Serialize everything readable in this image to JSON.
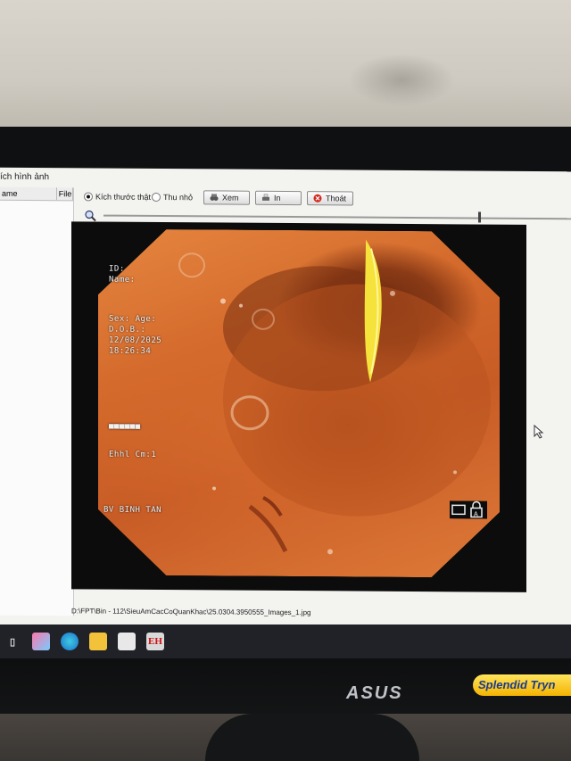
{
  "window": {
    "title_fragment": "ích hình ảnh",
    "left_headers": [
      "ame",
      "File"
    ]
  },
  "toolbar": {
    "radio_actual": "Kích thước thật",
    "radio_small": "Thu nhỏ",
    "btn_view": "Xem",
    "btn_print": "In",
    "btn_exit": "Thoát",
    "selected_radio": "actual"
  },
  "zoom": {
    "level": 0.78
  },
  "overlay": {
    "id": "ID:",
    "name": "Name:",
    "sex_age": "Sex:   Age:",
    "dob": "D.O.B.:",
    "date": "12/08/2025",
    "time": "18:26:34",
    "mask": "▀▀▀▀▀▀",
    "channel": "Ehhl Cm:1",
    "hospital": "BV BINH TAN"
  },
  "status": {
    "path": "D:\\FPT\\Bin - 112\\SieuAmCacCoQuanKhac\\25.0304.3950555_Images_1.jpg"
  },
  "taskbar": {
    "app_label": "EH"
  },
  "monitor": {
    "brand": "ASUS",
    "badge": "Splendid Tryn"
  },
  "colors": {
    "mucosa": "#d3692b",
    "exit_icon": "#d42a1e",
    "app_icon_bg": "#d9d9d9",
    "app_icon_text": "#cc1111"
  }
}
